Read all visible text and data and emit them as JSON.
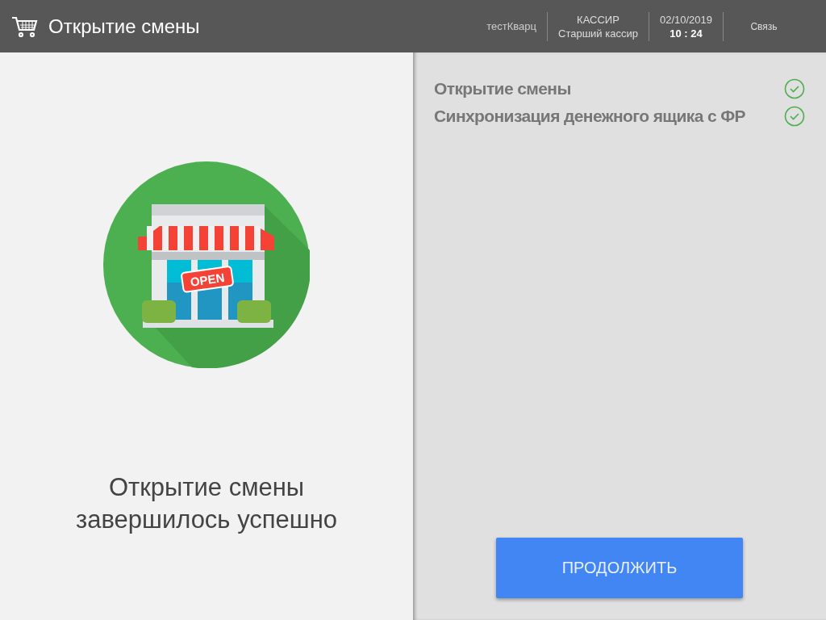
{
  "header": {
    "title": "Открытие смены",
    "user": "тестКварц",
    "role": "КАССИР",
    "position": "Старший кассир",
    "date": "02/10/2019",
    "time": "10 : 24",
    "link": "Связь"
  },
  "illustration": {
    "sign": "OPEN"
  },
  "message": [
    "Открытие смены",
    "завершилось успешно"
  ],
  "steps": [
    {
      "label": "Открытие смены",
      "done": true
    },
    {
      "label": "Синхронизация денежного ящика с ФР",
      "done": true
    }
  ],
  "continue_button": "ПРОДОЛЖИТЬ"
}
